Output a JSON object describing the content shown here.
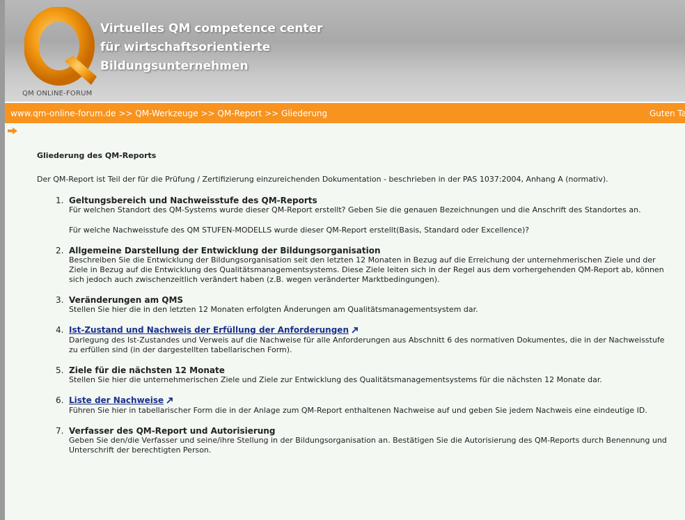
{
  "header": {
    "title_lines": [
      "Virtuelles QM competence center",
      "für wirtschaftsorientierte",
      "Bildungsunternehmen"
    ],
    "forum_label": "QM ONLINE-FORUM",
    "logo_letter": "Q"
  },
  "nav": {
    "breadcrumb": "www.qm-online-forum.de >> QM-Werkzeuge >> QM-Report >> Gliederung",
    "greeting": "Guten Ta"
  },
  "main": {
    "title": "Gliederung des QM-Reports",
    "intro": "Der QM-Report ist Teil der für die Prüfung / Zertifizierung einzureichenden Dokumentation - beschrieben in der PAS 1037:2004, Anhang A (normativ).",
    "items": [
      {
        "num": "1.",
        "title": "Geltungsbereich und Nachweisstufe des QM-Reports",
        "text": "Für welchen Standort des QM-Systems wurde dieser QM-Report erstellt? Geben Sie die genauen Bezeichnungen und die Anschrift des Standortes an.",
        "extra": "Für welche Nachweisstufe des QM STUFEN-MODELLS wurde dieser QM-Report erstellt(Basis, Standard oder Excellence)?"
      },
      {
        "num": "2.",
        "title": "Allgemeine Darstellung der Entwicklung der Bildungsorganisation",
        "text": "Beschreiben Sie die Entwicklung der Bildungsorganisation seit den letzten 12 Monaten in Bezug auf die Erreichung der unternehmerischen Ziele und der Ziele in Bezug auf die Entwicklung des Qualitätsmanagementsystems. Diese Ziele leiten sich in der Regel aus dem vorhergehenden QM-Report ab, können sich jedoch auch zwischenzeitlich verändert haben (z.B. wegen veränderter Marktbedingungen)."
      },
      {
        "num": "3.",
        "title": "Veränderungen am QMS",
        "text": "Stellen Sie hier die in den letzten 12 Monaten erfolgten Änderungen am Qualitätsmanagementsystem dar."
      },
      {
        "num": "4.",
        "link": "Ist-Zustand und Nachweis der Erfüllung der Anforderungen",
        "text": "Darlegung des Ist-Zustandes und Verweis auf die Nachweise für alle Anforderungen aus Abschnitt 6 des normativen Dokumentes, die in der Nachweisstufe zu erfüllen sind (in der dargestellten tabellarischen Form)."
      },
      {
        "num": "5.",
        "title": "Ziele für die nächsten 12 Monate",
        "text": "Stellen Sie hier die unternehmerischen Ziele und Ziele zur Entwicklung des Qualitätsmanagementsystems für die nächsten 12 Monate dar."
      },
      {
        "num": "6.",
        "link": "Liste der Nachweise",
        "text": "Führen Sie hier in tabellarischer Form die in der Anlage zum QM-Report enthaltenen Nachweise auf und geben Sie jedem Nachweis eine eindeutige ID."
      },
      {
        "num": "7.",
        "title": "Verfasser des QM-Report und Autorisierung",
        "text": "Geben Sie den/die Verfasser und seine/ihre Stellung in der Bildungsorganisation an. Bestätigen Sie die Autorisierung des QM-Reports durch Benennung und Unterschrift der berechtigten Person."
      }
    ]
  },
  "colors": {
    "nav_orange": "#f7931e",
    "link_blue": "#1b2f8a",
    "content_bg": "#f3f8f3",
    "logo_orange": "#f08c00"
  }
}
